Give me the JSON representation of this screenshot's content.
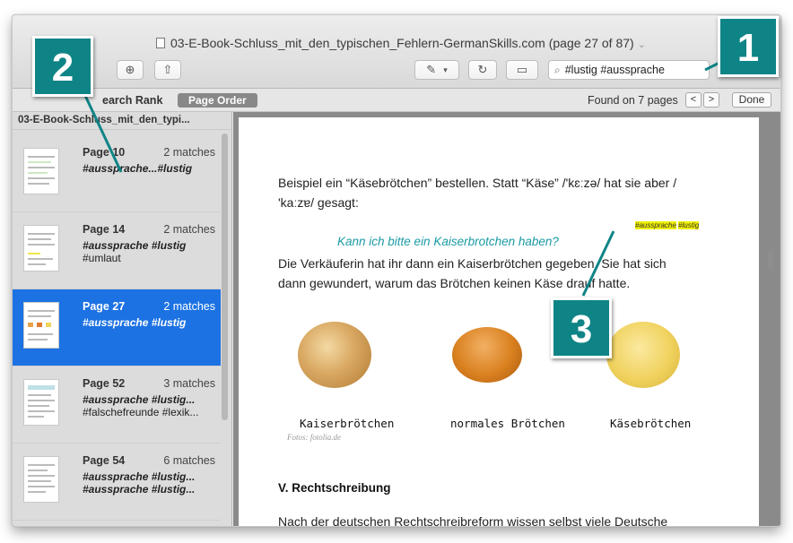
{
  "window": {
    "title": "03-E-Book-Schluss_mit_den_typischen_Fehlern-GermanSkills.com (page 27 of 87)"
  },
  "toolbar": {
    "search_value": "#lustig #aussprache",
    "icons": [
      "zoom-in-icon",
      "share-icon",
      "markup-icon",
      "chevron-down-icon",
      "rotate-icon",
      "toolbox-icon",
      "search-icon"
    ]
  },
  "findbar": {
    "search_rank": "earch Rank",
    "page_order": "Page Order",
    "found": "Found on 7 pages",
    "prev": "<",
    "next": ">",
    "done": "Done"
  },
  "sidebar": {
    "header": "03-E-Book-Schluss_mit_den_typi...",
    "results": [
      {
        "page": "Page 10",
        "matches": "2 matches",
        "line1": "#aussprache...#lustig",
        "line2": "",
        "line2_style": "plain"
      },
      {
        "page": "Page 14",
        "matches": "2 matches",
        "line1": "#aussprache #lustig",
        "line2": "#umlaut",
        "line2_style": "plain"
      },
      {
        "page": "Page 27",
        "matches": "2 matches",
        "line1": "#aussprache #lustig",
        "line2": "",
        "line2_style": "plain"
      },
      {
        "page": "Page 52",
        "matches": "3 matches",
        "line1": "#aussprache #lustig...",
        "line2": "#falschefreunde #lexik...",
        "line2_style": "plain"
      },
      {
        "page": "Page 54",
        "matches": "6 matches",
        "line1": "#aussprache #lustig...",
        "line2": "#aussprache #lustig...",
        "line2_style": "bold-italic"
      }
    ]
  },
  "document": {
    "para1_line1": "Beispiel ein “Käsebrötchen” bestellen. Statt “Käse” /'kɛːzə/ hat sie aber /",
    "para1_line2": "'kaːzɐ/ gesagt:",
    "quote": "Kann ich bitte ein Kaiserbrotchen haben?",
    "tags_hash1": "#aussprache",
    "tags_hash2": "#lustig",
    "para2_line1": "Die Verkäuferin hat ihr dann ein Kaiserbrötchen gegeben. Sie hat sich",
    "para2_line2": "dann gewundert, warum das Brötchen keinen Käse drauf hatte.",
    "captions": [
      "Kaiserbrötchen",
      "normales Brötchen",
      "Käsebrötchen"
    ],
    "credit": "Fotos: fotolia.de",
    "heading": "V. Rechtschreibung",
    "para3": "Nach der deutschen Rechtschreibreform wissen selbst viele Deutsche"
  },
  "callouts": [
    "1",
    "2",
    "3"
  ],
  "colors": {
    "accent": "#1c72e3",
    "callout": "#0f8486",
    "teal_text": "#1b9aa5",
    "highlight": "#f0f000"
  }
}
